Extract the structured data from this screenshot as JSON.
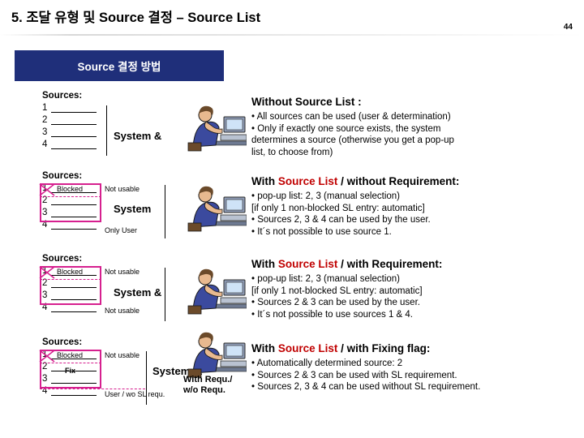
{
  "slide": {
    "title": "5. 조달 유형 및 Source 결정 – Source List",
    "page_number": "44",
    "header_box": "Source 결정 방법"
  },
  "blocks": [
    {
      "id": "block1",
      "sources_label": "Sources:",
      "rows": [
        "1",
        "2",
        "3",
        "4"
      ],
      "system_label": "System &",
      "notes": [],
      "right": {
        "heading": "Without Source List :",
        "heading_parts": [
          {
            "text": "Without Source List :",
            "color": "#000000"
          }
        ],
        "lines": [
          "• All sources can be used (user & determination)",
          "• Only if exactly one source exists, the system",
          "   determines a source  (otherwise you get a pop-up",
          "   list, to choose from)"
        ]
      }
    },
    {
      "id": "block2",
      "sources_label": "Sources:",
      "rows": [
        "1",
        "2",
        "3",
        "4"
      ],
      "system_label": "System",
      "notes": [
        "Blocked",
        "Not usable",
        "Only User"
      ],
      "right": {
        "heading_prefix": "With ",
        "heading_mid": "Source List",
        "heading_suffix": " / without Requirement:",
        "lines": [
          "• pop-up list: 2, 3 (manual selection)",
          "   [if only 1 non-blocked SL entry: automatic]",
          "• Sources 2, 3 & 4 can be used by the user.",
          "• It´s not possible to use source 1."
        ]
      }
    },
    {
      "id": "block3",
      "sources_label": "Sources:",
      "rows": [
        "1",
        "2",
        "3",
        "4"
      ],
      "system_label": "System &",
      "notes": [
        "Blocked",
        "Not usable",
        "Not usable"
      ],
      "right": {
        "heading_prefix": "With ",
        "heading_mid": "Source List",
        "heading_suffix": " / with Requirement:",
        "lines": [
          "• pop-up list: 2, 3 (manual selection)",
          "   [if only 1 not-blocked SL entry: automatic]",
          "• Sources 2 & 3 can be used by the user.",
          "• It´s not possible to use sources 1 & 4."
        ]
      }
    },
    {
      "id": "block4",
      "sources_label": "Sources:",
      "rows": [
        "1",
        "2",
        "3",
        "4"
      ],
      "system_label": "System: 2",
      "notes": [
        "Blocked",
        "Fix",
        "Not usable",
        "User / wo SL requ."
      ],
      "req_label_1": "With Requ./",
      "req_label_2": "w/o Requ.",
      "right": {
        "heading_prefix": "With ",
        "heading_mid": "Source List",
        "heading_suffix": " / with Fixing flag:",
        "lines": [
          "• Automatically determined source: 2",
          "• Sources 2 & 3 can be used with SL requirement.",
          "• Sources 2, 3 & 4 can be used without SL requirement."
        ]
      }
    }
  ],
  "colors": {
    "header_box_bg": "#1f2f7a",
    "magenta": "#d6208f",
    "source_list_red": "#c00000"
  }
}
